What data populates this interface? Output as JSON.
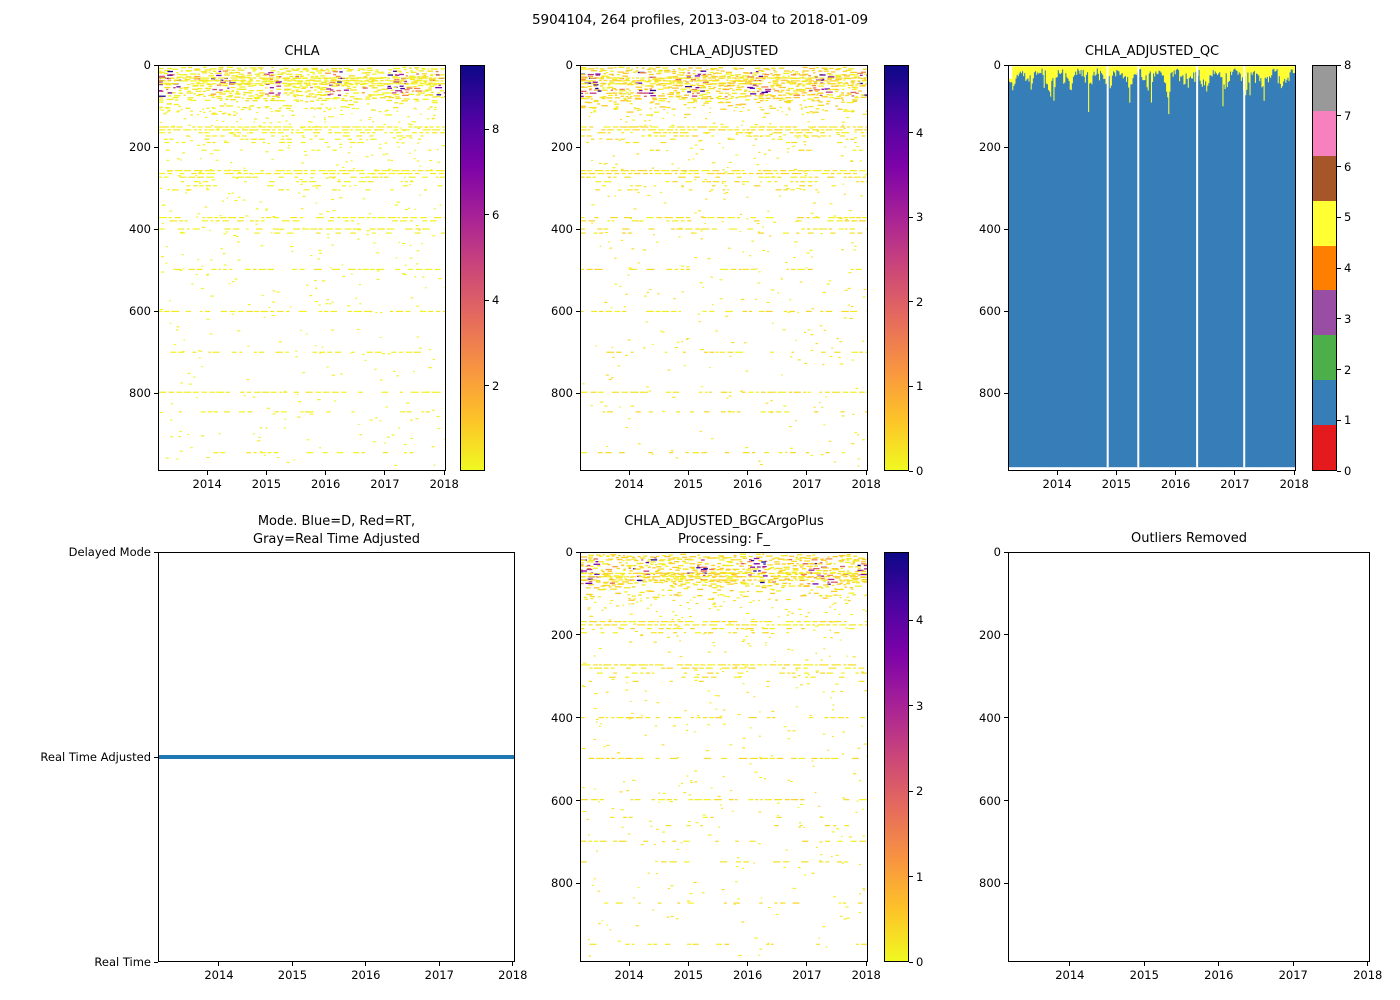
{
  "figure": {
    "title": "5904104, 264 profiles, 2013-03-04 to 2018-01-09",
    "background": "#ffffff"
  },
  "colors": {
    "plasma_low_to_high": [
      "#f0f921",
      "#fdc328",
      "#f89441",
      "#e56b5d",
      "#cb4679",
      "#a82296",
      "#7d03a8",
      "#4b03a1",
      "#0d0887"
    ],
    "qc_set1_0_to_8": [
      "#e41a1c",
      "#377eb8",
      "#4daf4a",
      "#984ea3",
      "#ff7f00",
      "#ffff33",
      "#a65628",
      "#f781bf",
      "#999999"
    ],
    "mode_line": "#1f77b4",
    "axis": "#000000"
  },
  "chart_data": [
    {
      "id": "chla",
      "type": "heatmap",
      "title": "CHLA",
      "x_range": [
        2013.17,
        2018.03
      ],
      "x_ticks": [
        "2014",
        "2015",
        "2016",
        "2017",
        "2018"
      ],
      "x_tick_pos": [
        0.1708,
        0.3765,
        0.5823,
        0.788,
        0.9938
      ],
      "y_ticks": [
        "0",
        "200",
        "400",
        "600",
        "800"
      ],
      "y_tick_pos": [
        0,
        0.202,
        0.404,
        0.6061,
        0.8081
      ],
      "y_max_depth": 990,
      "colorbar": {
        "style": "gradient",
        "vmin": 0,
        "vmax": 9.5,
        "ticks": [
          "2",
          "4",
          "6",
          "8"
        ],
        "tick_vals": [
          2,
          4,
          6,
          8
        ]
      },
      "pattern": {
        "seed": 11,
        "bloom_centers": [
          2013.3,
          2014.2,
          2015.1,
          2016.15,
          2017.2,
          2018.0
        ],
        "bloom_halfwidth": 0.17,
        "surface": {
          "top": 4,
          "core": 75,
          "fade": 118
        },
        "bands": [
          [
            28,
            0.95
          ],
          [
            35,
            0.9
          ],
          [
            42,
            0.8
          ],
          [
            148,
            0.9
          ],
          [
            155,
            0.85
          ],
          [
            162,
            0.6
          ],
          [
            170,
            0.4
          ],
          [
            178,
            0.35
          ],
          [
            186,
            0.25
          ],
          [
            205,
            0.15
          ],
          [
            255,
            0.9
          ],
          [
            262,
            0.8
          ],
          [
            271,
            0.5
          ],
          [
            282,
            0.35
          ],
          [
            292,
            0.3
          ],
          [
            302,
            0.2
          ],
          [
            370,
            0.65
          ],
          [
            378,
            0.5
          ],
          [
            398,
            0.6
          ],
          [
            408,
            0.3
          ],
          [
            497,
            0.6
          ],
          [
            600,
            0.55
          ],
          [
            700,
            0.6
          ],
          [
            798,
            0.7
          ],
          [
            846,
            0.3
          ],
          [
            946,
            0.33
          ]
        ],
        "speckles": 500
      }
    },
    {
      "id": "chla_adjusted",
      "type": "heatmap",
      "title": "CHLA_ADJUSTED",
      "x_range": [
        2013.17,
        2018.03
      ],
      "x_ticks": [
        "2014",
        "2015",
        "2016",
        "2017",
        "2018"
      ],
      "x_tick_pos": [
        0.1708,
        0.3765,
        0.5823,
        0.788,
        0.9938
      ],
      "y_ticks": [
        "0",
        "200",
        "400",
        "600",
        "800"
      ],
      "y_tick_pos": [
        0,
        0.202,
        0.404,
        0.6061,
        0.8081
      ],
      "y_max_depth": 990,
      "colorbar": {
        "style": "gradient",
        "vmin": 0,
        "vmax": 4.8,
        "ticks": [
          "0",
          "1",
          "2",
          "3",
          "4"
        ],
        "tick_vals": [
          0,
          1,
          2,
          3,
          4
        ]
      },
      "pattern": {
        "seed": 22,
        "bloom_centers": [
          2013.3,
          2014.2,
          2015.1,
          2016.15,
          2017.2,
          2018.0
        ],
        "bloom_halfwidth": 0.17,
        "surface": {
          "top": 4,
          "core": 75,
          "fade": 118
        },
        "bands": [
          [
            28,
            0.95
          ],
          [
            35,
            0.9
          ],
          [
            42,
            0.8
          ],
          [
            148,
            0.9
          ],
          [
            155,
            0.85
          ],
          [
            162,
            0.6
          ],
          [
            170,
            0.4
          ],
          [
            178,
            0.35
          ],
          [
            186,
            0.25
          ],
          [
            205,
            0.15
          ],
          [
            255,
            0.9
          ],
          [
            262,
            0.8
          ],
          [
            271,
            0.5
          ],
          [
            282,
            0.35
          ],
          [
            292,
            0.3
          ],
          [
            302,
            0.2
          ],
          [
            370,
            0.65
          ],
          [
            378,
            0.5
          ],
          [
            398,
            0.6
          ],
          [
            408,
            0.3
          ],
          [
            497,
            0.6
          ],
          [
            600,
            0.55
          ],
          [
            700,
            0.6
          ],
          [
            798,
            0.7
          ],
          [
            846,
            0.3
          ],
          [
            946,
            0.33
          ]
        ],
        "speckles": 420
      }
    },
    {
      "id": "chla_adjusted_qc",
      "type": "qc",
      "title": "CHLA_ADJUSTED_QC",
      "x_range": [
        2013.17,
        2018.03
      ],
      "x_ticks": [
        "2014",
        "2015",
        "2016",
        "2017",
        "2018"
      ],
      "x_tick_pos": [
        0.1708,
        0.3765,
        0.5823,
        0.788,
        0.9938
      ],
      "y_ticks": [
        "0",
        "200",
        "400",
        "600",
        "800"
      ],
      "y_tick_pos": [
        0,
        0.202,
        0.404,
        0.6061,
        0.8081
      ],
      "y_max_depth": 990,
      "colorbar": {
        "style": "discrete",
        "ticks": [
          "0",
          "1",
          "2",
          "3",
          "4",
          "5",
          "6",
          "7",
          "8"
        ]
      },
      "bars": {
        "count": 264,
        "seed": 33,
        "surface_qc_value": 5,
        "deep_qc_value": 1,
        "bottom_depth": 983,
        "gap_times": [
          2014.83,
          2015.35,
          2016.35,
          2017.15
        ]
      }
    },
    {
      "id": "mode",
      "type": "mode",
      "title": "Mode. Blue=D, Red=RT,\nGray=Real Time Adjusted",
      "x_range": [
        2013.17,
        2018.03
      ],
      "x_ticks": [
        "2014",
        "2015",
        "2016",
        "2017",
        "2018"
      ],
      "x_tick_pos": [
        0.1708,
        0.3765,
        0.5823,
        0.788,
        0.9938
      ],
      "y_categories": [
        "Delayed Mode",
        "Real Time Adjusted",
        "Real Time"
      ],
      "line_category": "Real Time Adjusted",
      "line_span": [
        0,
        1
      ]
    },
    {
      "id": "chla_adjusted_bgcargoplus",
      "type": "heatmap",
      "title": "CHLA_ADJUSTED_BGCArgoPlus\nProcessing: F_",
      "x_range": [
        2013.17,
        2018.03
      ],
      "x_ticks": [
        "2014",
        "2015",
        "2016",
        "2017",
        "2018"
      ],
      "x_tick_pos": [
        0.1708,
        0.3765,
        0.5823,
        0.788,
        0.9938
      ],
      "y_ticks": [
        "0",
        "200",
        "400",
        "600",
        "800"
      ],
      "y_tick_pos": [
        0,
        0.202,
        0.404,
        0.6061,
        0.8081
      ],
      "y_max_depth": 990,
      "colorbar": {
        "style": "gradient",
        "vmin": 0,
        "vmax": 4.8,
        "ticks": [
          "0",
          "1",
          "2",
          "3",
          "4"
        ],
        "tick_vals": [
          0,
          1,
          2,
          3,
          4
        ]
      },
      "pattern": {
        "seed": 55,
        "bloom_centers": [
          2013.3,
          2014.2,
          2015.1,
          2016.15,
          2017.2,
          2018.0
        ],
        "bloom_halfwidth": 0.17,
        "surface": {
          "top": 4,
          "core": 72,
          "fade": 115
        },
        "bands": [
          [
            48,
            0.95
          ],
          [
            56,
            0.9
          ],
          [
            64,
            0.85
          ],
          [
            165,
            0.85
          ],
          [
            173,
            0.7
          ],
          [
            182,
            0.45
          ],
          [
            192,
            0.3
          ],
          [
            270,
            0.85
          ],
          [
            278,
            0.6
          ],
          [
            290,
            0.4
          ],
          [
            300,
            0.3
          ],
          [
            310,
            0.2
          ],
          [
            398,
            0.6
          ],
          [
            497,
            0.65
          ],
          [
            597,
            0.55
          ],
          [
            640,
            0.25
          ],
          [
            660,
            0.2
          ],
          [
            698,
            0.45
          ],
          [
            748,
            0.45
          ],
          [
            848,
            0.35
          ],
          [
            948,
            0.35
          ]
        ],
        "speckles": 430
      }
    },
    {
      "id": "outliers_removed",
      "type": "empty",
      "title": "Outliers Removed",
      "x_range": [
        2013.17,
        2018.03
      ],
      "x_ticks": [
        "2014",
        "2015",
        "2016",
        "2017",
        "2018"
      ],
      "x_tick_pos": [
        0.1708,
        0.3765,
        0.5823,
        0.788,
        0.9938
      ],
      "y_ticks": [
        "0",
        "200",
        "400",
        "600",
        "800"
      ],
      "y_tick_pos": [
        0,
        0.202,
        0.404,
        0.6061,
        0.8081
      ],
      "y_max_depth": 990
    }
  ]
}
